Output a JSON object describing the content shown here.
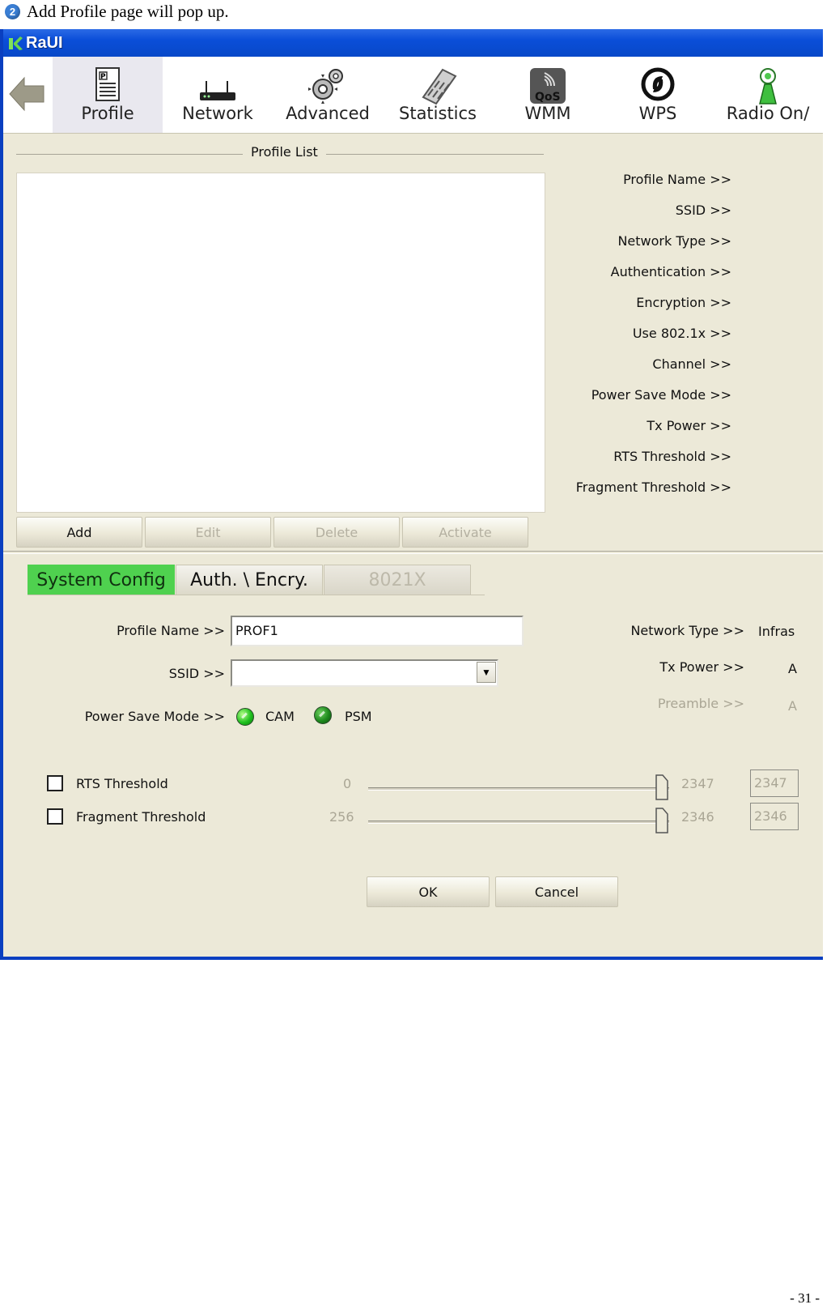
{
  "document": {
    "caption_step": "2",
    "caption": "Add Profile page will pop up.",
    "page_number": "- 31 -"
  },
  "window": {
    "title": "RaUI",
    "toolbar": [
      {
        "label": "Profile",
        "icon": "profile-icon",
        "active": true
      },
      {
        "label": "Network",
        "icon": "network-icon"
      },
      {
        "label": "Advanced",
        "icon": "advanced-gears-icon"
      },
      {
        "label": "Statistics",
        "icon": "statistics-calculator-icon"
      },
      {
        "label": "WMM",
        "icon": "wmm-qos-icon"
      },
      {
        "label": "WPS",
        "icon": "wps-icon"
      },
      {
        "label": "Radio On/",
        "icon": "radio-antenna-icon"
      }
    ]
  },
  "profile_list": {
    "title": "Profile List",
    "buttons": {
      "add": "Add",
      "edit": "Edit",
      "delete": "Delete",
      "activate": "Activate"
    },
    "details": [
      "Profile Name >>",
      "SSID >>",
      "Network Type >>",
      "Authentication >>",
      "Encryption >>",
      "Use 802.1x >>",
      "Channel >>",
      "Power Save Mode >>",
      "Tx Power >>",
      "RTS Threshold >>",
      "Fragment Threshold >>"
    ]
  },
  "tabs": {
    "system_config": "System Config",
    "auth_encry": "Auth. \\ Encry.",
    "x8021": "8021X"
  },
  "form": {
    "profile_name_label": "Profile Name >>",
    "profile_name_value": "PROF1",
    "ssid_label": "SSID >>",
    "ssid_value": "",
    "power_save_label": "Power Save Mode >>",
    "cam_label": "CAM",
    "psm_label": "PSM",
    "network_type_label": "Network Type >>",
    "network_type_value": "Infras",
    "tx_power_label": "Tx Power >>",
    "tx_power_value": "A",
    "preamble_label": "Preamble >>",
    "preamble_value": "A",
    "rts": {
      "label": "RTS Threshold",
      "min": "0",
      "max": "2347",
      "value": "2347"
    },
    "fragment": {
      "label": "Fragment Threshold",
      "min": "256",
      "max": "2346",
      "value": "2346"
    },
    "ok": "OK",
    "cancel": "Cancel"
  },
  "colors": {
    "accent_tab": "#4fd14f",
    "title_bar": "#0a4ed8",
    "panel": "#ece9d8"
  }
}
